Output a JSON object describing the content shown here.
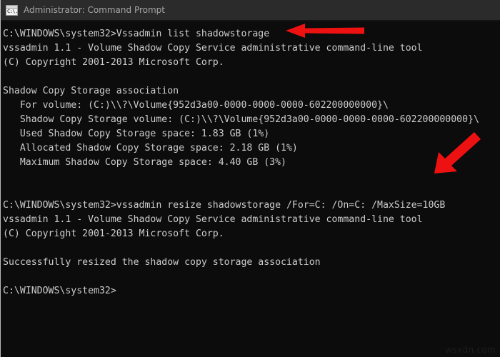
{
  "window": {
    "title": "Administrator: Command Prompt",
    "icon": "command-prompt-icon",
    "icon_glyph": "C:\\.",
    "background_color": "#0c0c0c",
    "titlebar_color": "#2b2b2b",
    "text_color": "#cccccc"
  },
  "console": {
    "lines": [
      "C:\\WINDOWS\\system32>Vssadmin list shadowstorage",
      "vssadmin 1.1 - Volume Shadow Copy Service administrative command-line tool",
      "(C) Copyright 2001-2013 Microsoft Corp.",
      "",
      "Shadow Copy Storage association",
      "   For volume: (C:)\\\\?\\Volume{952d3a00-0000-0000-0000-602200000000}\\",
      "   Shadow Copy Storage volume: (C:)\\\\?\\Volume{952d3a00-0000-0000-0000-602200000000}\\",
      "   Used Shadow Copy Storage space: 1.83 GB (1%)",
      "   Allocated Shadow Copy Storage space: 2.18 GB (1%)",
      "   Maximum Shadow Copy Storage space: 4.40 GB (3%)",
      "",
      "",
      "C:\\WINDOWS\\system32>vssadmin resize shadowstorage /For=C: /On=C: /MaxSize=10GB",
      "vssadmin 1.1 - Volume Shadow Copy Service administrative command-line tool",
      "(C) Copyright 2001-2013 Microsoft Corp.",
      "",
      "Successfully resized the shadow copy storage association",
      "",
      "C:\\WINDOWS\\system32>"
    ]
  },
  "annotations": {
    "color": "#ee1111",
    "arrows": [
      {
        "name": "arrow-pointing-to-list-command",
        "direction": "left"
      },
      {
        "name": "arrow-pointing-to-resize-command",
        "direction": "down-left"
      }
    ]
  },
  "watermark": {
    "text": "wsxdn.com"
  }
}
